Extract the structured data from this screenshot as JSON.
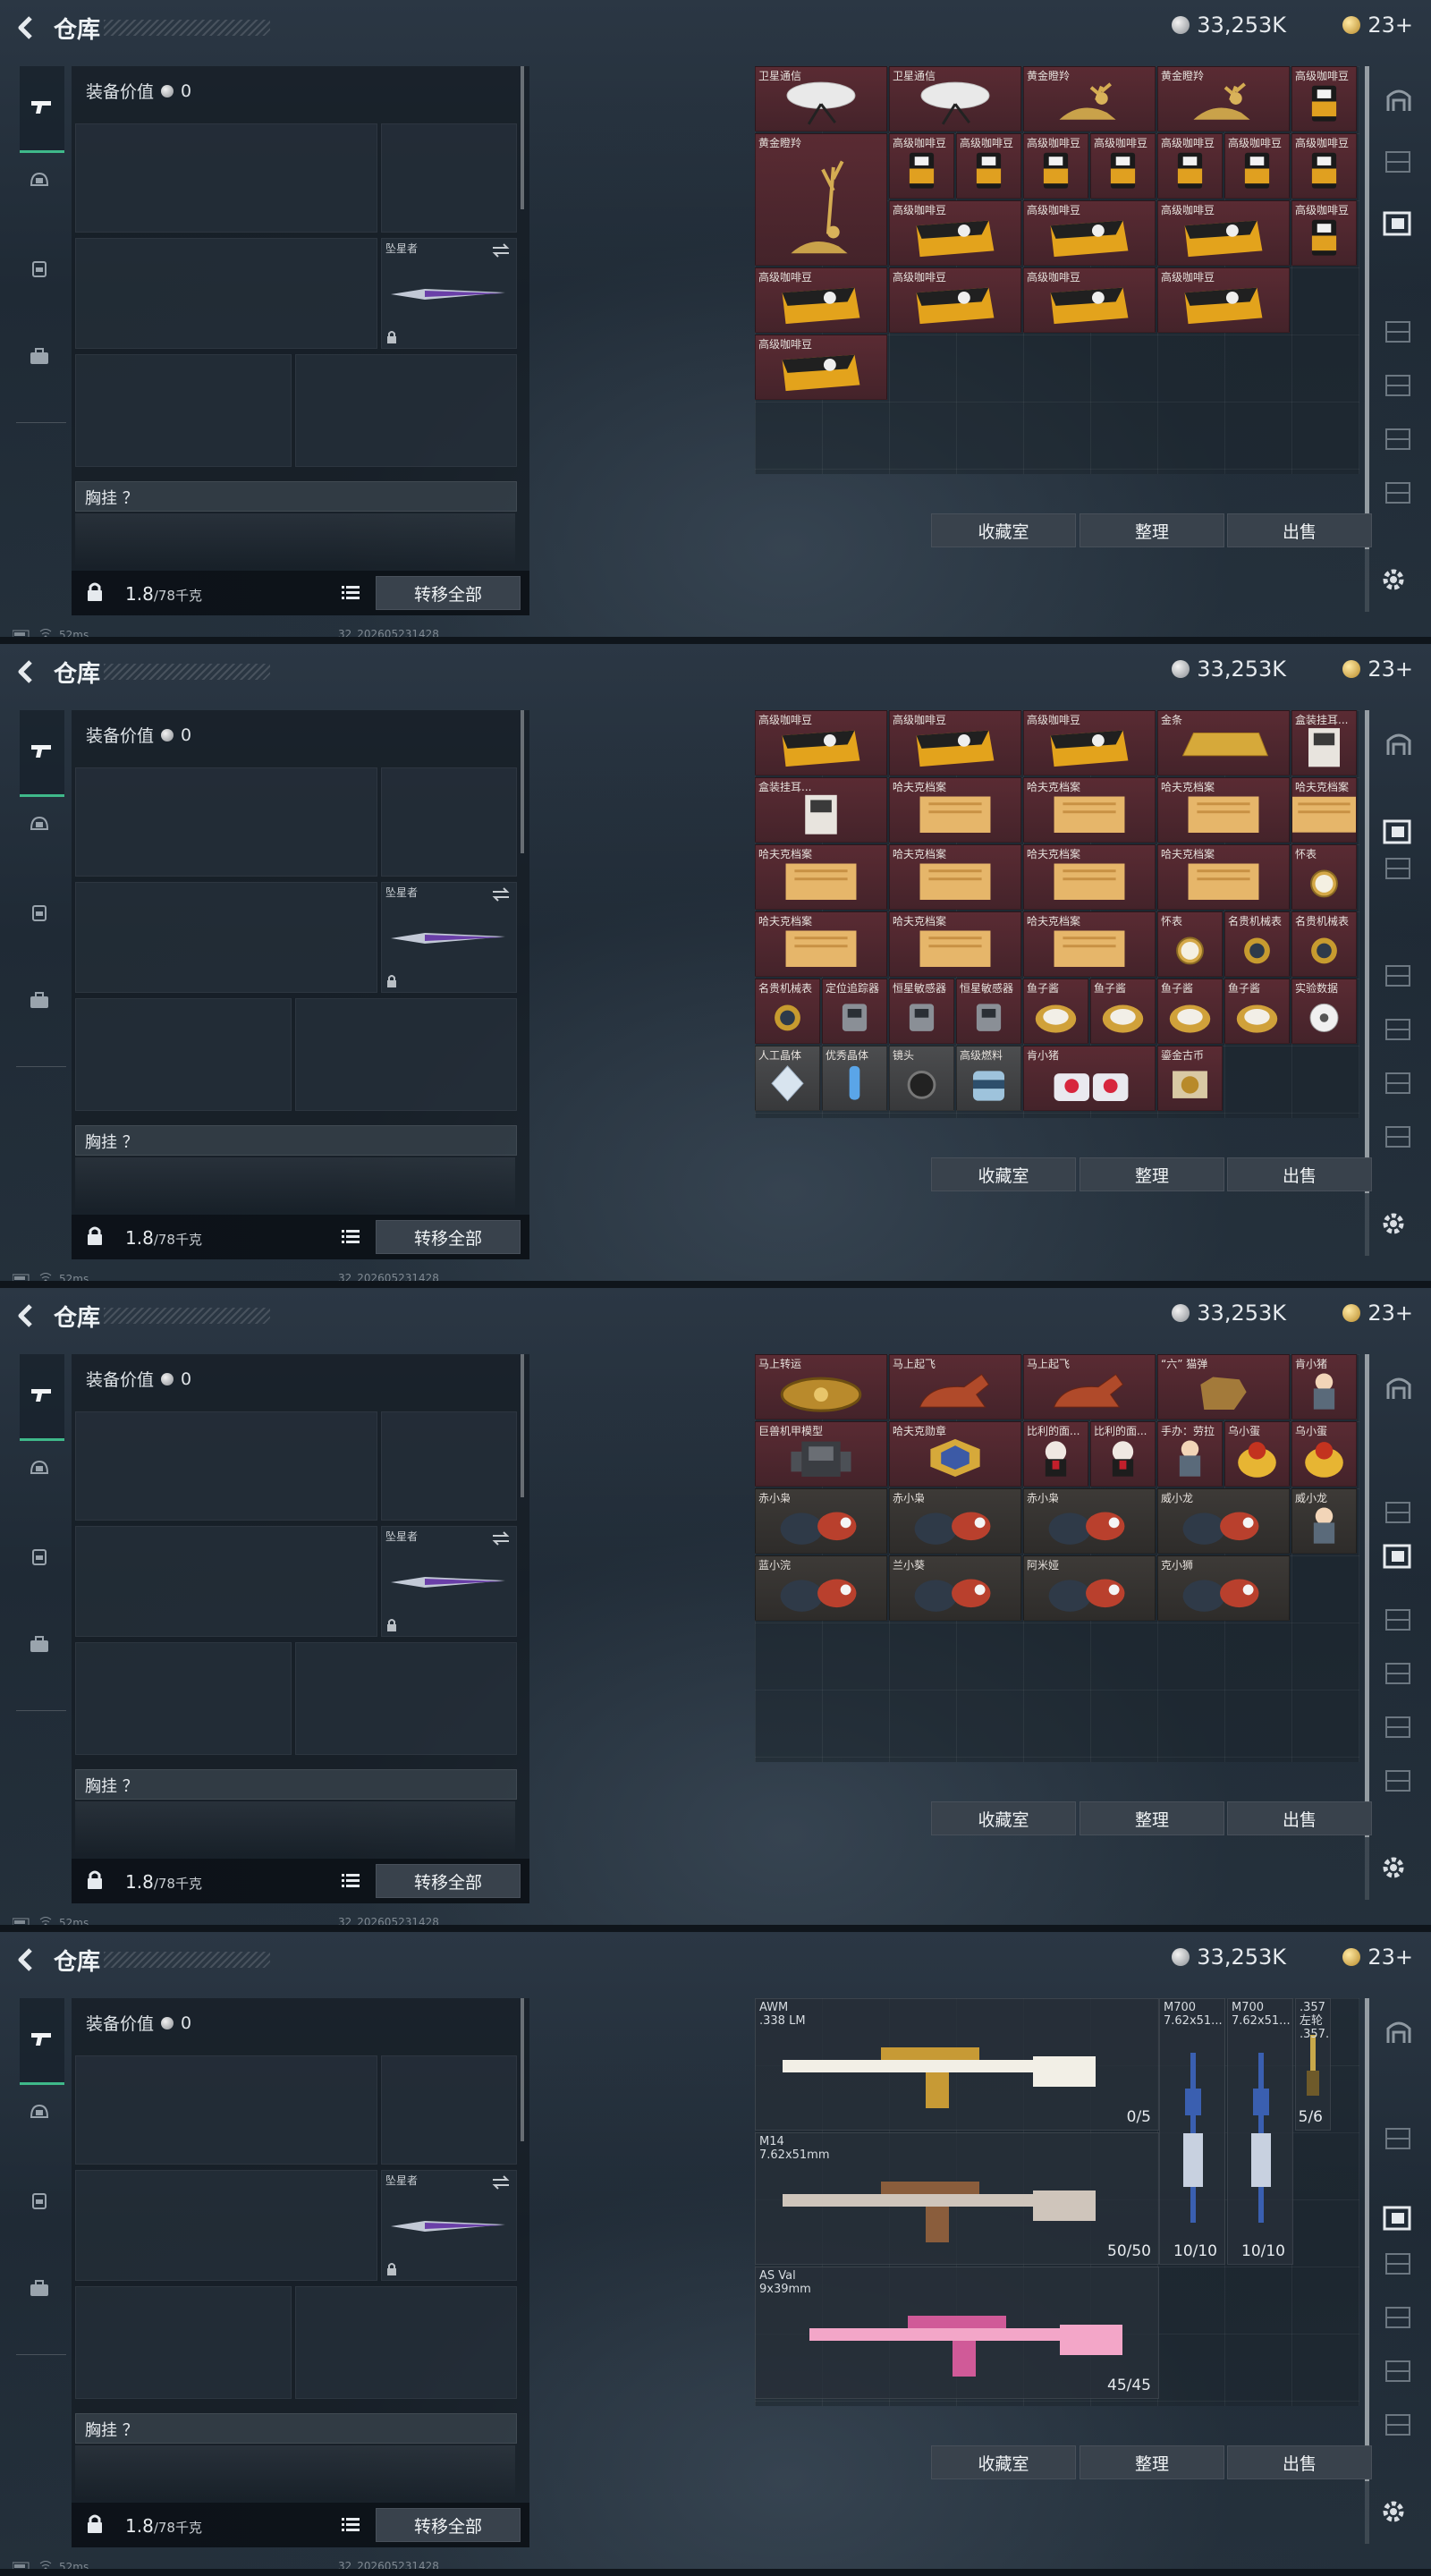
{
  "header": {
    "title": "仓库",
    "silver_amount": "33,253K",
    "gold_amount": "23+"
  },
  "equipment": {
    "value_label": "装备价值",
    "value": "0",
    "melee_name": "坠星者",
    "chest_label": "胸挂 ？",
    "weight_current": "1.8",
    "weight_max": "/78千克",
    "transfer_all": "转移全部"
  },
  "footer": {
    "collection": "收藏室",
    "sort": "整理",
    "sell": "出售"
  },
  "status": {
    "ping": "52ms",
    "build": "32_202605231428"
  },
  "icons": {
    "back": "chevron-left-icon",
    "silver": "silver-coin-icon",
    "gold": "gold-coin-icon",
    "settings": "gear-icon"
  },
  "screens": [
    {
      "items": [
        {
          "label": "卫星通信",
          "art": "dish",
          "tone": "red"
        },
        {
          "label": "卫星通信",
          "art": "dish",
          "tone": "red"
        },
        {
          "label": "黄金瞪羚",
          "art": "deer",
          "tone": "red"
        },
        {
          "label": "黄金瞪羚",
          "art": "deer",
          "tone": "red"
        },
        {
          "label": "高级咖啡豆",
          "art": "coffee",
          "tone": "red",
          "half": true
        },
        {
          "label": "黄金瞪羚",
          "art": "deer",
          "tone": "red"
        },
        {
          "label": "高级咖啡豆",
          "art": "coffee",
          "tone": "red",
          "half": true
        },
        {
          "label": "高级咖啡豆",
          "art": "coffee",
          "tone": "red",
          "half": true
        },
        {
          "label": "高级咖啡豆",
          "art": "coffee",
          "tone": "red",
          "half": true
        },
        {
          "label": "高级咖啡豆",
          "art": "coffee",
          "tone": "red",
          "half": true
        },
        {
          "label": "高级咖啡豆",
          "art": "coffee",
          "tone": "red",
          "half": true
        },
        {
          "label": "高级咖啡豆",
          "art": "coffee",
          "tone": "red",
          "half": true
        },
        {
          "label": "高级咖啡豆",
          "art": "coffee",
          "tone": "red",
          "half": true
        },
        {
          "label": "高级咖啡豆",
          "art": "box",
          "tone": "red"
        },
        {
          "label": "高级咖啡豆",
          "art": "box",
          "tone": "red"
        },
        {
          "label": "高级咖啡豆",
          "art": "box",
          "tone": "red"
        },
        {
          "label": "高级咖啡豆",
          "art": "box",
          "tone": "red"
        },
        {
          "label": "高级咖啡豆",
          "art": "coffee",
          "tone": "red",
          "half": true
        },
        {
          "label": "高级咖啡豆",
          "art": "box",
          "tone": "red"
        },
        {
          "label": "高级咖啡豆",
          "art": "box",
          "tone": "red"
        },
        {
          "label": "高级咖啡豆",
          "art": "box",
          "tone": "red"
        },
        {
          "label": "高级咖啡豆",
          "art": "box",
          "tone": "red"
        }
      ]
    },
    {
      "items": [
        {
          "label": "高级咖啡豆",
          "art": "box",
          "tone": "red"
        },
        {
          "label": "高级咖啡豆",
          "art": "box",
          "tone": "red"
        },
        {
          "label": "高级咖啡豆",
          "art": "box",
          "tone": "red"
        },
        {
          "label": "金条",
          "art": "goldbar",
          "tone": "red"
        },
        {
          "label": "盒装挂耳...",
          "art": "carton",
          "tone": "red",
          "half": true
        },
        {
          "label": "盒装挂耳...",
          "art": "carton",
          "tone": "red"
        },
        {
          "label": "哈夫克档案",
          "art": "folder",
          "tone": "red"
        },
        {
          "label": "哈夫克档案",
          "art": "folder",
          "tone": "red"
        },
        {
          "label": "哈夫克档案",
          "art": "folder",
          "tone": "red"
        },
        {
          "label": "哈夫克档案",
          "art": "folder",
          "tone": "red"
        },
        {
          "label": "哈夫克档案",
          "art": "folder",
          "tone": "red"
        },
        {
          "label": "哈夫克档案",
          "art": "folder",
          "tone": "red"
        },
        {
          "label": "哈夫克档案",
          "art": "folder",
          "tone": "red"
        },
        {
          "label": "哈夫克档案",
          "art": "folder",
          "tone": "red",
          "half": true
        },
        {
          "label": "哈夫克档案",
          "art": "folder",
          "tone": "red"
        },
        {
          "label": "哈夫克档案",
          "art": "folder",
          "tone": "red"
        },
        {
          "label": "哈夫克档案",
          "art": "folder",
          "tone": "red"
        },
        {
          "label": "怀表",
          "art": "watch",
          "tone": "red",
          "half": true
        },
        {
          "label": "怀表",
          "art": "watch",
          "tone": "red",
          "half": true
        },
        {
          "label": "名贵机械表",
          "art": "ring",
          "tone": "red",
          "half": true
        },
        {
          "label": "名贵机械表",
          "art": "ring",
          "tone": "red",
          "half": true
        },
        {
          "label": "名贵机械表",
          "art": "ring",
          "tone": "red",
          "half": true
        },
        {
          "label": "定位追踪器",
          "art": "gadget",
          "tone": "red",
          "half": true
        },
        {
          "label": "恒星敏感器",
          "art": "gadget",
          "tone": "red",
          "half": true
        },
        {
          "label": "恒星敏感器",
          "art": "gadget",
          "tone": "red",
          "half": true
        },
        {
          "label": "鱼子酱",
          "art": "tin",
          "tone": "red",
          "half": true
        },
        {
          "label": "鱼子酱",
          "art": "tin",
          "tone": "red",
          "half": true
        },
        {
          "label": "鱼子酱",
          "art": "tin",
          "tone": "red",
          "half": true
        },
        {
          "label": "鱼子酱",
          "art": "tin",
          "tone": "red",
          "half": true
        },
        {
          "label": "实验数据",
          "art": "disc",
          "tone": "red",
          "half": true
        },
        {
          "label": "人工晶体",
          "art": "crystal",
          "tone": "gray",
          "half": true
        },
        {
          "label": "优秀晶体",
          "art": "vial",
          "tone": "gray",
          "half": true
        },
        {
          "label": "镜头",
          "art": "lens",
          "tone": "gray",
          "half": true
        },
        {
          "label": "高级燃料",
          "art": "can",
          "tone": "gray",
          "half": true
        },
        {
          "label": "肯小猪",
          "art": "toy",
          "tone": "red"
        },
        {
          "label": "鎏金古币",
          "art": "coin",
          "tone": "red",
          "half": true
        }
      ]
    },
    {
      "items": [
        {
          "label": "马上转运",
          "art": "wheel",
          "tone": "red"
        },
        {
          "label": "马上起飞",
          "art": "horse",
          "tone": "red"
        },
        {
          "label": "马上起飞",
          "art": "horse",
          "tone": "red"
        },
        {
          "label": "“六” 猫弹",
          "art": "hand",
          "tone": "red"
        },
        {
          "label": "肯小猪",
          "art": "figure",
          "tone": "red",
          "half": true
        },
        {
          "label": "巨兽机甲模型",
          "art": "mech",
          "tone": "red"
        },
        {
          "label": "哈夫克勋章",
          "art": "medal",
          "tone": "red"
        },
        {
          "label": "比利的面...",
          "art": "doll",
          "tone": "red",
          "half": true
        },
        {
          "label": "比利的面...",
          "art": "doll",
          "tone": "red",
          "half": true
        },
        {
          "label": "手办：劳拉",
          "art": "figure",
          "tone": "red",
          "half": true
        },
        {
          "label": "乌小蛋",
          "art": "egg",
          "tone": "red",
          "half": true
        },
        {
          "label": "乌小蛋",
          "art": "egg",
          "tone": "red",
          "half": true
        },
        {
          "label": "赤小枭",
          "art": "bird",
          "tone": "dark"
        },
        {
          "label": "赤小枭",
          "art": "bird",
          "tone": "dark"
        },
        {
          "label": "赤小枭",
          "art": "bird",
          "tone": "dark"
        },
        {
          "label": "威小龙",
          "art": "bird",
          "tone": "dark"
        },
        {
          "label": "威小龙",
          "art": "figure",
          "tone": "dark",
          "half": true
        },
        {
          "label": "蓝小浣",
          "art": "bird",
          "tone": "dark"
        },
        {
          "label": "兰小葵",
          "art": "bird",
          "tone": "dark"
        },
        {
          "label": "阿米娅",
          "art": "bird",
          "tone": "dark"
        },
        {
          "label": "克小狮",
          "art": "bird",
          "tone": "dark"
        }
      ]
    },
    {
      "weapons": [
        {
          "name": "AWM",
          "caliber": ".338 LM",
          "ammo": "0/5",
          "art": "sniper-gold"
        },
        {
          "name": "M14",
          "caliber": "7.62x51mm",
          "ammo": "50/50",
          "art": "rifle-brown"
        },
        {
          "name": "AS Val",
          "caliber": "9x39mm",
          "ammo": "45/45",
          "art": "rifle-pink"
        },
        {
          "name": "M700",
          "caliber": "7.62x51...",
          "ammo": "10/10",
          "art": "vertical-blue"
        },
        {
          "name": "M700",
          "caliber": "7.62x51...",
          "ammo": "10/10",
          "art": "vertical-blue"
        },
        {
          "name": ".357左轮",
          "caliber": ".357...",
          "ammo": "5/6",
          "art": "revolver"
        }
      ]
    }
  ]
}
